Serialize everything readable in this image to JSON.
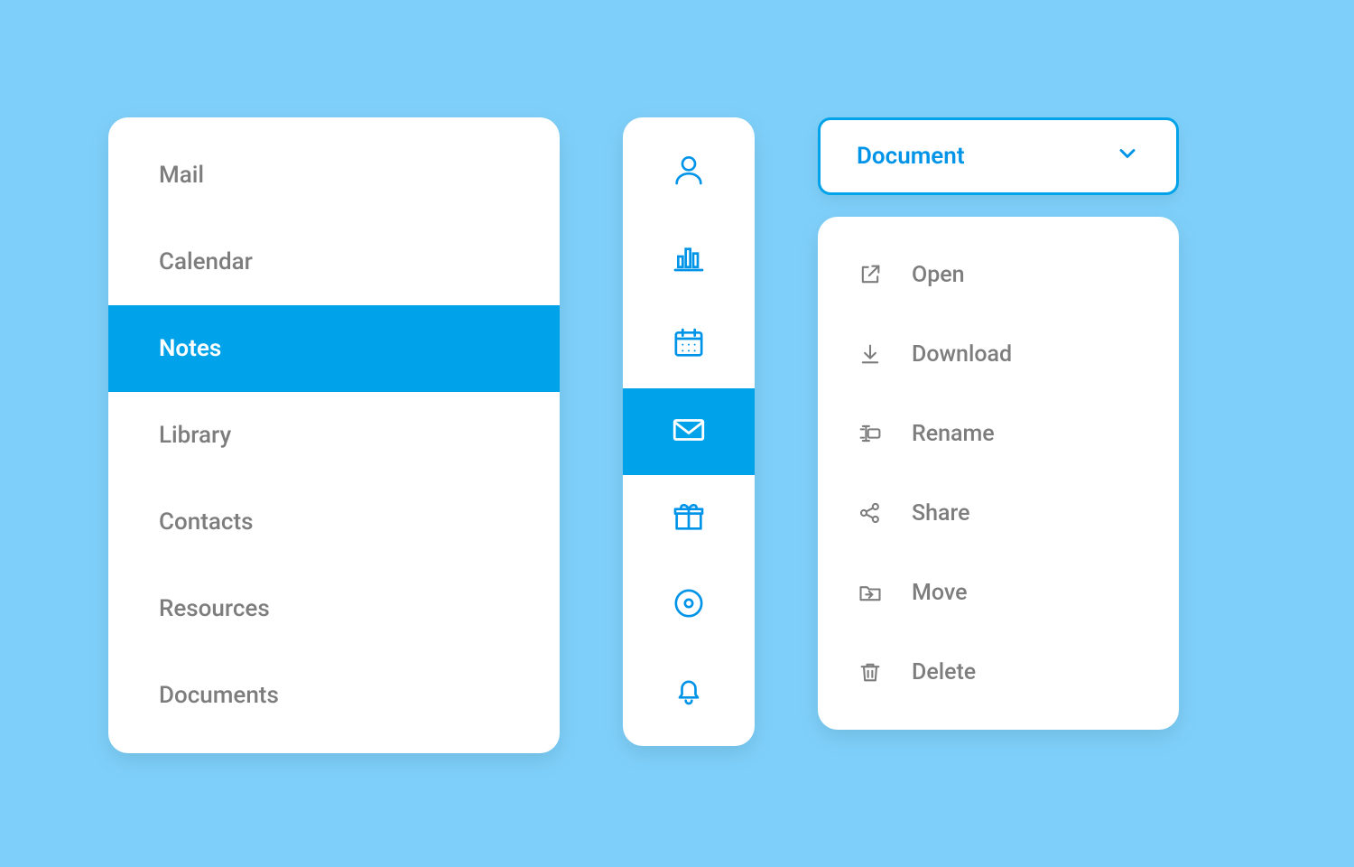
{
  "colors": {
    "background": "#7ed0fa",
    "accent": "#00a3e9",
    "text_muted": "#7d7d7d",
    "white": "#ffffff"
  },
  "sidebar": {
    "items": [
      {
        "label": "Mail",
        "selected": false,
        "icon": "mail-icon"
      },
      {
        "label": "Calendar",
        "selected": false,
        "icon": "calendar-icon"
      },
      {
        "label": "Notes",
        "selected": true,
        "icon": "notes-icon"
      },
      {
        "label": "Library",
        "selected": false,
        "icon": "library-icon"
      },
      {
        "label": "Contacts",
        "selected": false,
        "icon": "contacts-icon"
      },
      {
        "label": "Resources",
        "selected": false,
        "icon": "resources-icon"
      },
      {
        "label": "Documents",
        "selected": false,
        "icon": "documents-icon"
      }
    ]
  },
  "icon_rail": {
    "items": [
      {
        "icon": "user-icon",
        "selected": false
      },
      {
        "icon": "bar-chart-icon",
        "selected": false
      },
      {
        "icon": "calendar-icon",
        "selected": false
      },
      {
        "icon": "mail-icon",
        "selected": true
      },
      {
        "icon": "gift-icon",
        "selected": false
      },
      {
        "icon": "disc-icon",
        "selected": false
      },
      {
        "icon": "bell-icon",
        "selected": false
      }
    ]
  },
  "dropdown": {
    "label": "Document",
    "expanded": false
  },
  "context_menu": {
    "items": [
      {
        "label": "Open",
        "icon": "external-link-icon"
      },
      {
        "label": "Download",
        "icon": "download-icon"
      },
      {
        "label": "Rename",
        "icon": "rename-icon"
      },
      {
        "label": "Share",
        "icon": "share-icon"
      },
      {
        "label": "Move",
        "icon": "folder-move-icon"
      },
      {
        "label": "Delete",
        "icon": "trash-icon"
      }
    ]
  }
}
